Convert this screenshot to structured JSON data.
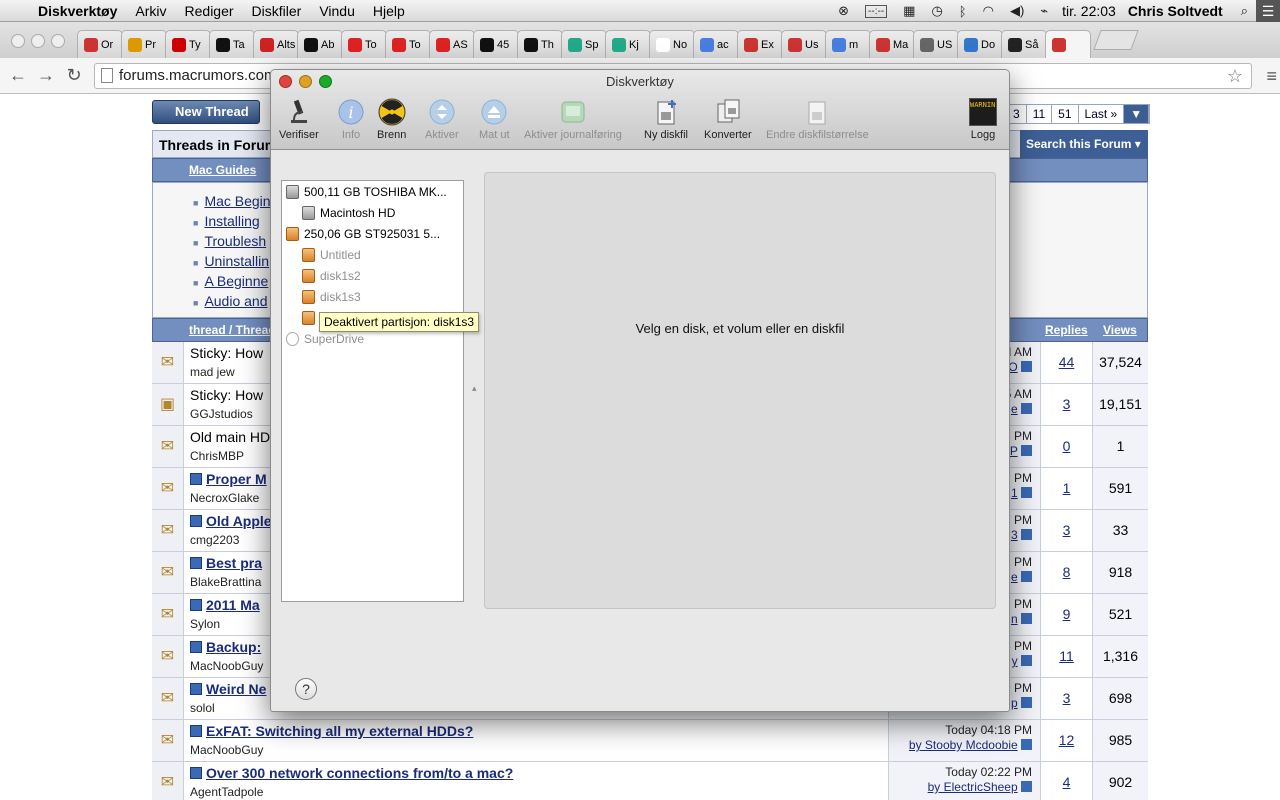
{
  "menubar": {
    "app_name": "Diskverktøy",
    "menus": [
      "Arkiv",
      "Rediger",
      "Diskfiler",
      "Vindu",
      "Hjelp"
    ],
    "clock": "tir. 22:03",
    "user": "Chris Soltvedt",
    "battery_text": "--:--"
  },
  "browser": {
    "tabs": [
      "Or",
      "Pr",
      "Ty",
      "Ta",
      "Alts",
      "Ab",
      "To",
      "To",
      "AS",
      "45",
      "Th",
      "Sp",
      "Kj",
      "No",
      "ac",
      "Ex",
      "Us",
      "m",
      "Ma",
      "US",
      "Do",
      "Så",
      ""
    ],
    "url": "forums.macrumors.com"
  },
  "forum": {
    "new_thread": "New Thread",
    "pager": [
      "3",
      "11",
      "51",
      "Last »"
    ],
    "threads_title": "Threads in Forum",
    "search_forum": "Search this Forum",
    "guides_header": "Mac Guides",
    "guides": [
      "Mac Beginn",
      "Installing",
      "Troublesh",
      "Uninstallin",
      "A Beginne",
      "Audio and"
    ],
    "col_thread": "thread / Thread",
    "col_replies": "Replies",
    "col_views": "Views",
    "rows": [
      {
        "title": "Sticky: How",
        "poster": "mad jew",
        "time": "M AM",
        "by": "O",
        "replies": "44",
        "views": "37,524"
      },
      {
        "title": "Sticky: How",
        "poster": "GGJstudios",
        "time": "5 AM",
        "by": "e",
        "replies": "3",
        "views": "19,151"
      },
      {
        "title": "Old main HD",
        "poster": "ChrisMBP",
        "time": "5 PM",
        "by": "P",
        "replies": "0",
        "views": "1"
      },
      {
        "title": "Proper M",
        "poster": "NecroxGlake",
        "time": "2 PM",
        "by": "1",
        "replies": "1",
        "views": "591"
      },
      {
        "title": "Old Apple",
        "poster": "cmg2203",
        "time": "7 PM",
        "by": "3",
        "replies": "3",
        "views": "33"
      },
      {
        "title": "Best pra",
        "poster": "BlakeBrattina",
        "time": "1 PM",
        "by": "e",
        "replies": "8",
        "views": "918"
      },
      {
        "title": "2011 Ma",
        "poster": "Sylon",
        "time": "2 PM",
        "by": "n",
        "replies": "9",
        "views": "521"
      },
      {
        "title": "Backup:",
        "poster": "MacNoobGuy",
        "time": "5 PM",
        "by": "y",
        "replies": "11",
        "views": "1,316"
      },
      {
        "title": "Weird Ne",
        "poster": "solol",
        "time": "9 PM",
        "by": "p",
        "replies": "3",
        "views": "698"
      },
      {
        "title": "ExFAT: Switching all my external HDDs?",
        "poster": "MacNoobGuy",
        "time": "Today 04:18 PM",
        "by": "by Stooby Mcdoobie",
        "replies": "12",
        "views": "985"
      },
      {
        "title": "Over 300 network connections from/to a mac?",
        "poster": "AgentTadpole",
        "time": "Today 02:22 PM",
        "by": "by ElectricSheep",
        "replies": "4",
        "views": "902"
      }
    ]
  },
  "disk_utility": {
    "title": "Diskverktøy",
    "toolbar": {
      "verify": "Verifiser",
      "info": "Info",
      "burn": "Brenn",
      "enable": "Aktiver",
      "eject": "Mat ut",
      "journaling": "Aktiver journalføring",
      "new_image": "Ny diskfil",
      "convert": "Konverter",
      "resize": "Endre diskfilstørrelse",
      "log": "Logg",
      "log_badge": "WARNIN"
    },
    "disks": [
      {
        "label": "500,11 GB TOSHIBA MK...",
        "kind": "hd"
      },
      {
        "label": "Macintosh HD",
        "kind": "hd"
      },
      {
        "label": "250,06 GB ST925031 5...",
        "kind": "ext"
      },
      {
        "label": "Untitled",
        "kind": "ext"
      },
      {
        "label": "disk1s2",
        "kind": "ext"
      },
      {
        "label": "disk1s3",
        "kind": "ext"
      },
      {
        "label": "",
        "kind": "ext"
      },
      {
        "label": "SuperDrive",
        "kind": "optical"
      }
    ],
    "tooltip": "Deaktivert partisjon: disk1s3",
    "main_message": "Velg en disk, et volum eller en diskfil",
    "help": "?"
  }
}
